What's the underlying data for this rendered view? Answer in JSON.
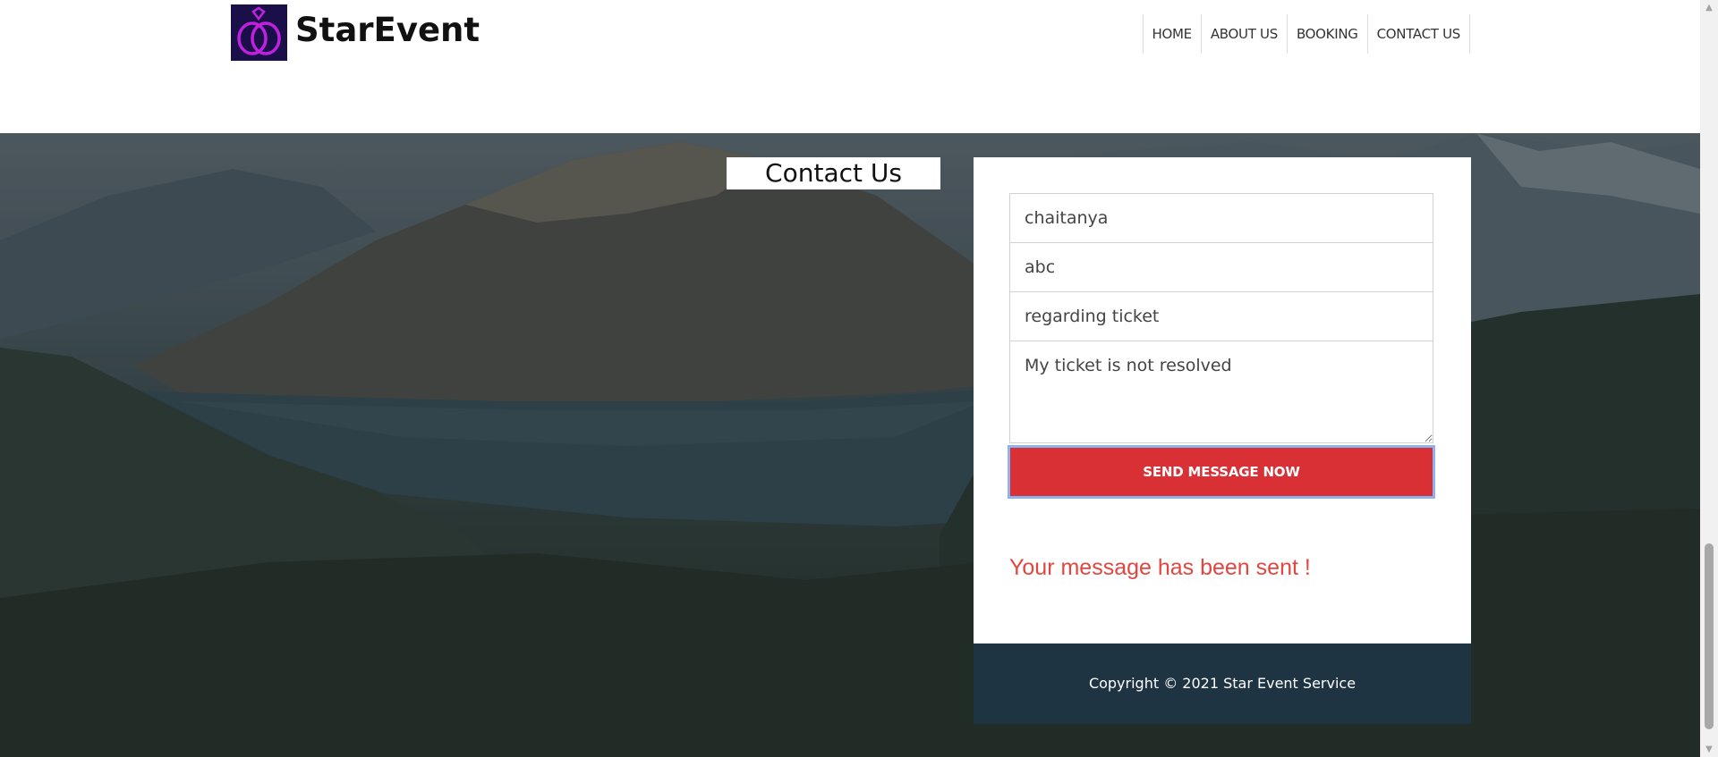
{
  "header": {
    "brand": "StarEvent",
    "logo_icon": "rings-icon",
    "nav": [
      {
        "label": "HOME"
      },
      {
        "label": "ABOUT US"
      },
      {
        "label": "BOOKING"
      },
      {
        "label": "CONTACT US"
      }
    ]
  },
  "contact": {
    "heading": "Contact Us",
    "form": {
      "name_value": "chaitanya",
      "email_value": "abc",
      "subject_value": "regarding ticket",
      "message_value": "My ticket is not resolved",
      "submit_label": "SEND MESSAGE NOW"
    },
    "status_message": "Your message has been sent !",
    "status_color": "#e2463e"
  },
  "footer": {
    "copyright": "Copyright © 2021 Star Event Service"
  },
  "colors": {
    "button": "#d93036",
    "footer": "#1f3443",
    "logo_background": "#1b0f4a",
    "logo_rings": "#c020e0"
  }
}
